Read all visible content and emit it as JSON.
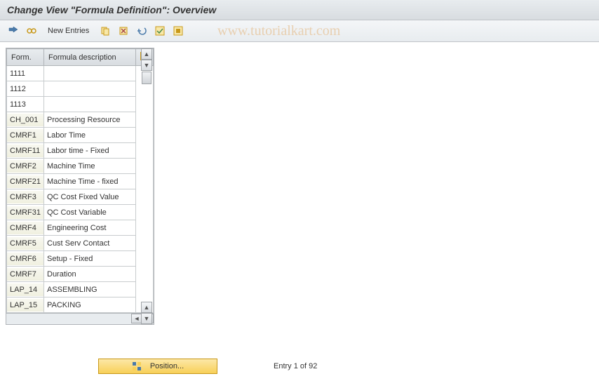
{
  "title": "Change View \"Formula Definition\": Overview",
  "toolbar": {
    "new_entries": "New Entries"
  },
  "watermark": "www.tutorialkart.com",
  "table": {
    "headers": {
      "form": "Form.",
      "desc": "Formula description"
    },
    "rows": [
      {
        "form": "1111",
        "desc": "",
        "editable": true
      },
      {
        "form": "1112",
        "desc": "",
        "editable": true
      },
      {
        "form": "1113",
        "desc": "",
        "editable": true
      },
      {
        "form": "CH_001",
        "desc": "Processing Resource",
        "editable": false
      },
      {
        "form": "CMRF1",
        "desc": "Labor Time",
        "editable": false
      },
      {
        "form": "CMRF11",
        "desc": "Labor time - Fixed",
        "editable": false
      },
      {
        "form": "CMRF2",
        "desc": "Machine Time",
        "editable": false
      },
      {
        "form": "CMRF21",
        "desc": "Machine Time - fixed",
        "editable": false
      },
      {
        "form": "CMRF3",
        "desc": "QC Cost Fixed Value",
        "editable": false
      },
      {
        "form": "CMRF31",
        "desc": "QC Cost Variable",
        "editable": false
      },
      {
        "form": "CMRF4",
        "desc": "Engineering Cost",
        "editable": false
      },
      {
        "form": "CMRF5",
        "desc": "Cust Serv Contact",
        "editable": false
      },
      {
        "form": "CMRF6",
        "desc": "Setup - Fixed",
        "editable": false
      },
      {
        "form": "CMRF7",
        "desc": "Duration",
        "editable": false
      },
      {
        "form": "LAP_14",
        "desc": "ASSEMBLING",
        "editable": false
      },
      {
        "form": "LAP_15",
        "desc": "PACKING",
        "editable": false
      }
    ]
  },
  "footer": {
    "position_label": "Position...",
    "entry_status": "Entry 1 of 92"
  }
}
